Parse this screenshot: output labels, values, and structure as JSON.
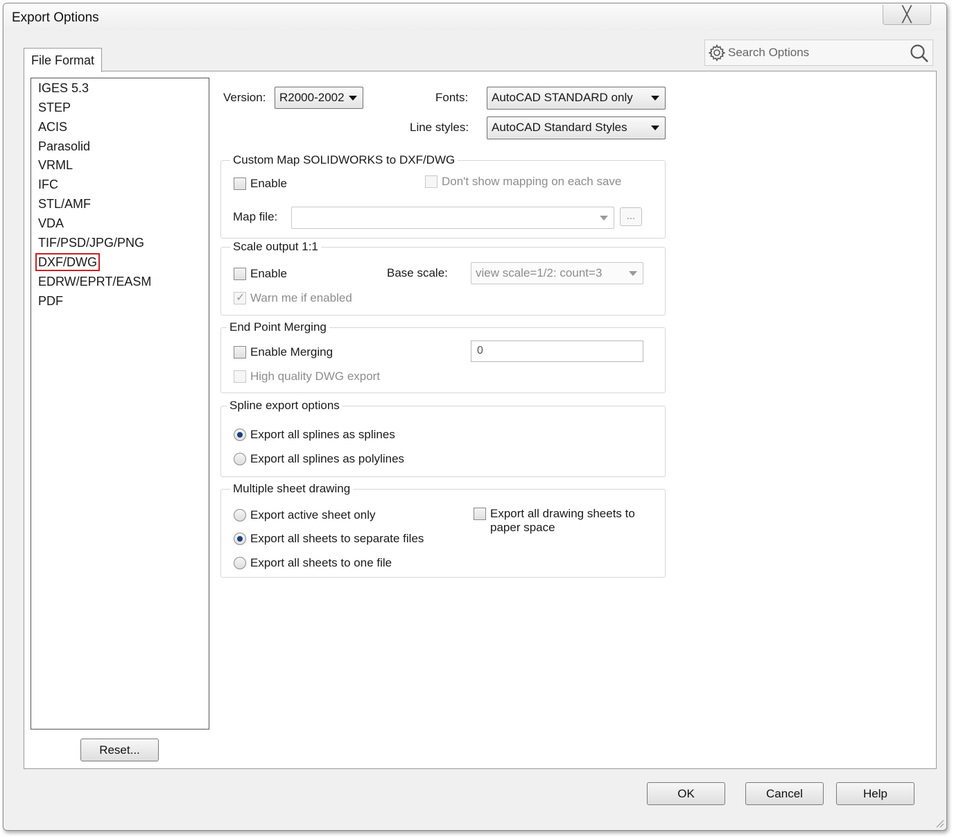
{
  "window": {
    "title": "Export Options",
    "close_glyph": "╳"
  },
  "tab": {
    "label": "File Format"
  },
  "search": {
    "label": "Search Options",
    "gear_icon": "gear-icon",
    "search_icon": "search-icon"
  },
  "formats": {
    "items": [
      "IGES 5.3",
      "STEP",
      "ACIS",
      "Parasolid",
      "VRML",
      "IFC",
      "STL/AMF",
      "VDA",
      "TIF/PSD/JPG/PNG",
      "DXF/DWG",
      "EDRW/EPRT/EASM",
      "PDF"
    ],
    "selected": "DXF/DWG",
    "highlight_color": "#cc1f1f"
  },
  "reset_label": "Reset...",
  "version": {
    "label": "Version:",
    "value": "R2000-2002"
  },
  "fonts": {
    "label": "Fonts:",
    "value": "AutoCAD STANDARD only"
  },
  "line_styles": {
    "label": "Line styles:",
    "value": "AutoCAD Standard Styles"
  },
  "custom_map": {
    "title": "Custom Map SOLIDWORKS to DXF/DWG",
    "enable_label": "Enable",
    "enable_checked": false,
    "dont_show_label": "Don't show mapping on each save",
    "dont_show_checked": false,
    "dont_show_disabled": true,
    "map_file_label": "Map file:",
    "map_file_value": "",
    "browse_label": "..."
  },
  "scale_output": {
    "title": "Scale output 1:1",
    "enable_label": "Enable",
    "enable_checked": false,
    "base_scale_label": "Base scale:",
    "base_scale_value": "view scale=1/2: count=3",
    "warn_label": "Warn me if enabled",
    "warn_checked": true,
    "warn_disabled": true
  },
  "end_point_merging": {
    "title": "End Point Merging",
    "enable_label": "Enable Merging",
    "enable_checked": false,
    "value": "0",
    "hq_label": "High quality DWG export",
    "hq_checked": false,
    "hq_disabled": true
  },
  "spline": {
    "title": "Spline export options",
    "options": [
      "Export all splines as splines",
      "Export all splines as polylines"
    ],
    "selected": "Export all splines as splines"
  },
  "multi_sheet": {
    "title": "Multiple sheet drawing",
    "options": [
      "Export active sheet only",
      "Export all sheets to separate files",
      "Export all sheets to one file"
    ],
    "selected": "Export all sheets to separate files",
    "paper_space_label_1": "Export all drawing sheets to",
    "paper_space_label_2": "paper space",
    "paper_space_checked": false
  },
  "footer": {
    "ok": "OK",
    "cancel": "Cancel",
    "help": "Help"
  },
  "colors": {
    "radio_dot": "#1b3f7a",
    "disabled_text": "#8d8d8d"
  }
}
